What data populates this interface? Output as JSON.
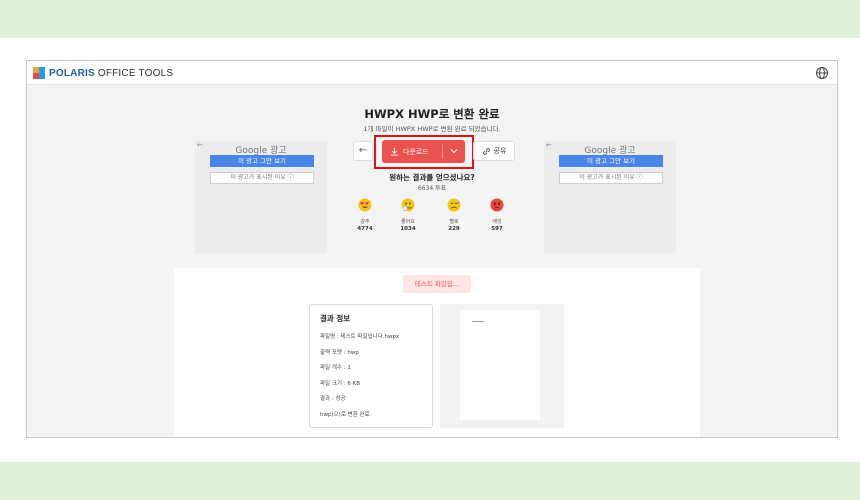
{
  "brand": {
    "name_bold": "POLARIS",
    "name_light": " OFFICE TOOLS"
  },
  "header": {
    "title": "HWPX HWP로 변환 완료",
    "subtitle": "1개 파일이 HWPX HWP로 변환 완료 되었습니다."
  },
  "ads": {
    "left": {
      "back": "←",
      "brand": "Google 광고",
      "stop_label": "이 광고 그만 보기",
      "why_label": "이 광고가 표시된 이유 ⓘ"
    },
    "right": {
      "back": "←",
      "brand": "Google 광고",
      "stop_label": "이 광고 그만 보기",
      "why_label": "이 광고가 표시된 이유 ⓘ"
    }
  },
  "actions": {
    "back": "←",
    "download_label": "다운로드",
    "share_label": "공유"
  },
  "feedback": {
    "question": "원하는 결과를 얻으셨나요?",
    "votes": "6634 투표",
    "reactions": [
      {
        "label": "강추",
        "count": "4774",
        "color": "#f5c518",
        "accent": "#e0245e"
      },
      {
        "label": "좋아요",
        "count": "1034",
        "color": "#f5c518",
        "accent": "#ffffff"
      },
      {
        "label": "별로",
        "count": "229",
        "color": "#f5c518",
        "accent": "#4aa3df"
      },
      {
        "label": "애잇",
        "count": "597",
        "color": "#e8483d",
        "accent": "#ffffff"
      }
    ]
  },
  "result": {
    "chip_label": "테스트 파일입...",
    "card_title": "결과 정보",
    "lines": [
      "파일명 : 테스트 파일입니다.hwpx",
      "출력 포맷 : hwp",
      "파일 개수 : 1",
      "파일 크기 : 6 KB",
      "결과 : 성공",
      "hwp(으)로 변환 완료"
    ]
  },
  "colors": {
    "accent_red": "#e9524e",
    "ad_blue": "#4a86e8",
    "brand_blue": "#1f5fa8",
    "highlight": "#e01212"
  }
}
